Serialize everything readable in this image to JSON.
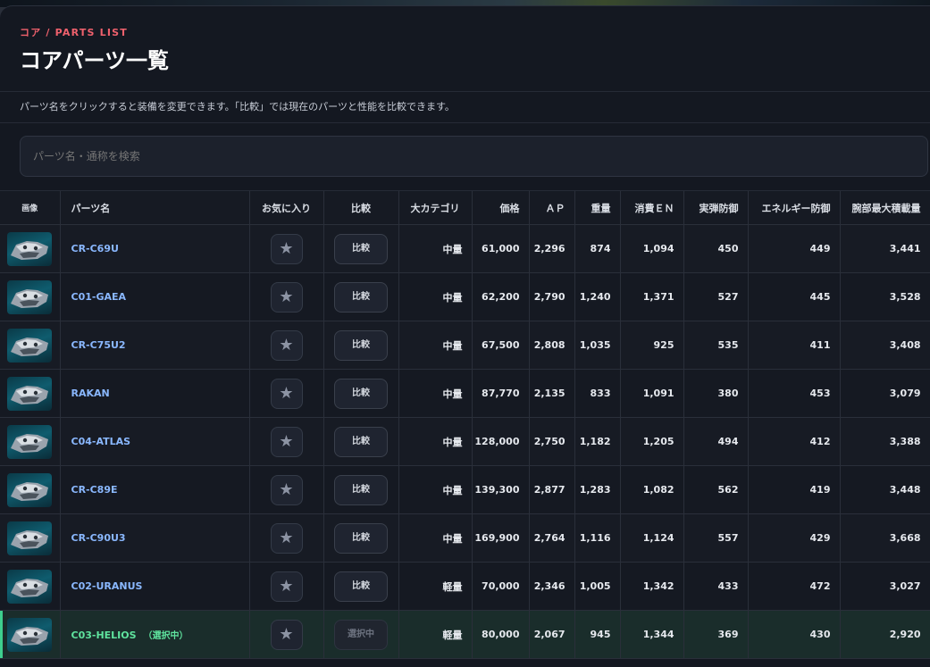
{
  "header": {
    "eyebrow": "コア / PARTS LIST",
    "title": "コアパーツ一覧",
    "description": "パーツ名をクリックすると装備を変更できます。「比較」では現在のパーツと性能を比較できます。"
  },
  "search": {
    "placeholder": "パーツ名・通称を検索",
    "value": ""
  },
  "columns": {
    "image": "画像",
    "name": "パーツ名",
    "favorite": "お気に入り",
    "compare": "比較",
    "category": "大カテゴリ",
    "price": "価格",
    "ap": "ＡＰ",
    "weight": "重量",
    "en": "消費ＥＮ",
    "kinetic": "実弾防御",
    "energy": "エネルギー防御",
    "arm_load": "腕部最大積載量"
  },
  "favorite_icon": "star-icon",
  "compare_label": "比較",
  "selected_label": "選択中",
  "selected_note": "（選択中）",
  "accent_colors": {
    "name_link": "#8ab8ff",
    "selected": "#5fe39e",
    "eyebrow": "#f0616d"
  },
  "rows": [
    {
      "name": "CR-C69U",
      "category": "中量",
      "price": "61,000",
      "ap": "2,296",
      "weight": "874",
      "en": "1,094",
      "kinetic": "450",
      "energy": "449",
      "arm_load": "3,441",
      "selected": false
    },
    {
      "name": "C01-GAEA",
      "category": "中量",
      "price": "62,200",
      "ap": "2,790",
      "weight": "1,240",
      "en": "1,371",
      "kinetic": "527",
      "energy": "445",
      "arm_load": "3,528",
      "selected": false
    },
    {
      "name": "CR-C75U2",
      "category": "中量",
      "price": "67,500",
      "ap": "2,808",
      "weight": "1,035",
      "en": "925",
      "kinetic": "535",
      "energy": "411",
      "arm_load": "3,408",
      "selected": false
    },
    {
      "name": "RAKAN",
      "category": "中量",
      "price": "87,770",
      "ap": "2,135",
      "weight": "833",
      "en": "1,091",
      "kinetic": "380",
      "energy": "453",
      "arm_load": "3,079",
      "selected": false
    },
    {
      "name": "C04-ATLAS",
      "category": "中量",
      "price": "128,000",
      "ap": "2,750",
      "weight": "1,182",
      "en": "1,205",
      "kinetic": "494",
      "energy": "412",
      "arm_load": "3,388",
      "selected": false
    },
    {
      "name": "CR-C89E",
      "category": "中量",
      "price": "139,300",
      "ap": "2,877",
      "weight": "1,283",
      "en": "1,082",
      "kinetic": "562",
      "energy": "419",
      "arm_load": "3,448",
      "selected": false
    },
    {
      "name": "CR-C90U3",
      "category": "中量",
      "price": "169,900",
      "ap": "2,764",
      "weight": "1,116",
      "en": "1,124",
      "kinetic": "557",
      "energy": "429",
      "arm_load": "3,668",
      "selected": false
    },
    {
      "name": "C02-URANUS",
      "category": "軽量",
      "price": "70,000",
      "ap": "2,346",
      "weight": "1,005",
      "en": "1,342",
      "kinetic": "433",
      "energy": "472",
      "arm_load": "3,027",
      "selected": false
    },
    {
      "name": "C03-HELIOS",
      "category": "軽量",
      "price": "80,000",
      "ap": "2,067",
      "weight": "945",
      "en": "1,344",
      "kinetic": "369",
      "energy": "430",
      "arm_load": "2,920",
      "selected": true
    }
  ]
}
